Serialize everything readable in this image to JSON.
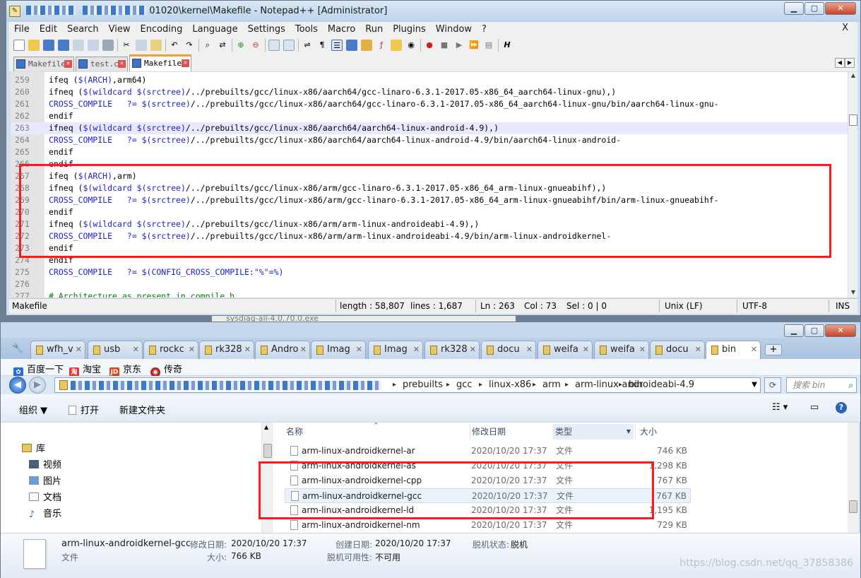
{
  "npp": {
    "title_suffix": "01020\\kernel\\Makefile - Notepad++ [Administrator]",
    "menu": [
      "File",
      "Edit",
      "Search",
      "View",
      "Encoding",
      "Language",
      "Settings",
      "Tools",
      "Macro",
      "Run",
      "Plugins",
      "Window",
      "?"
    ],
    "menu_close": "X",
    "tabs": [
      "Makefile",
      "test.c",
      "Makefile"
    ],
    "active_tab": 2,
    "lines": [
      {
        "n": "259",
        "t": "ifeq ($(ARCH),arm64)"
      },
      {
        "n": "260",
        "t": "ifneq ($(wildcard $(srctree)/../prebuilts/gcc/linux-x86/aarch64/gcc-linaro-6.3.1-2017.05-x86_64_aarch64-linux-gnu),)"
      },
      {
        "n": "261",
        "t": "CROSS_COMPILE   ?= $(srctree)/../prebuilts/gcc/linux-x86/aarch64/gcc-linaro-6.3.1-2017.05-x86_64_aarch64-linux-gnu/bin/aarch64-linux-gnu-"
      },
      {
        "n": "262",
        "t": "endif"
      },
      {
        "n": "263",
        "t": "ifneq ($(wildcard $(srctree)/../prebuilts/gcc/linux-x86/aarch64/aarch64-linux-android-4.9),)"
      },
      {
        "n": "264",
        "t": "CROSS_COMPILE   ?= $(srctree)/../prebuilts/gcc/linux-x86/aarch64/aarch64-linux-android-4.9/bin/aarch64-linux-android-"
      },
      {
        "n": "265",
        "t": "endif"
      },
      {
        "n": "266",
        "t": "endif"
      },
      {
        "n": "267",
        "t": "ifeq ($(ARCH),arm)"
      },
      {
        "n": "268",
        "t": "ifneq ($(wildcard $(srctree)/../prebuilts/gcc/linux-x86/arm/gcc-linaro-6.3.1-2017.05-x86_64_arm-linux-gnueabihf),)"
      },
      {
        "n": "269",
        "t": "CROSS_COMPILE   ?= $(srctree)/../prebuilts/gcc/linux-x86/arm/gcc-linaro-6.3.1-2017.05-x86_64_arm-linux-gnueabihf/bin/arm-linux-gnueabihf-"
      },
      {
        "n": "270",
        "t": "endif"
      },
      {
        "n": "271",
        "t": "ifneq ($(wildcard $(srctree)/../prebuilts/gcc/linux-x86/arm/arm-linux-androideabi-4.9),)"
      },
      {
        "n": "272",
        "t": "CROSS_COMPILE   ?= $(srctree)/../prebuilts/gcc/linux-x86/arm/arm-linux-androideabi-4.9/bin/arm-linux-androidkernel-"
      },
      {
        "n": "273",
        "t": "endif"
      },
      {
        "n": "274",
        "t": "endif"
      },
      {
        "n": "275",
        "t": "CROSS_COMPILE   ?= $(CONFIG_CROSS_COMPILE:\"%\"=%)"
      },
      {
        "n": "276",
        "t": ""
      },
      {
        "n": "277",
        "t": "# Architecture as present in compile.h"
      }
    ],
    "current_line_index": 4,
    "status": {
      "file": "Makefile",
      "length": "length : 58,807",
      "lines": "lines : 1,687",
      "ln": "Ln : 263",
      "col": "Col : 73",
      "sel": "Sel : 0 | 0",
      "eol": "Unix (LF)",
      "enc": "UTF-8",
      "mode": "INS"
    }
  },
  "background": {
    "filename_peek": "sysdiag-all-4.0.70.0.exe"
  },
  "explorer": {
    "tabs": [
      "wfh_v",
      "usb",
      "rockc",
      "rk328",
      "Andro",
      "Imag",
      "Imag",
      "rk328",
      "docu",
      "weifa",
      "weifa",
      "docu",
      "bin"
    ],
    "new_tab": "+",
    "favorites": [
      "百度一下",
      "淘宝",
      "京东",
      "传奇"
    ],
    "breadcrumbs": [
      "prebuilts",
      "gcc",
      "linux-x86",
      "arm",
      "arm-linux-androideabi-4.9",
      "bin"
    ],
    "search_placeholder": "搜索 bin",
    "commands": {
      "organize": "组织 ▼",
      "open": "打开",
      "new_folder": "新建文件夹"
    },
    "nav_tree": [
      {
        "label": "库",
        "level": 0
      },
      {
        "label": "视频",
        "level": 1
      },
      {
        "label": "图片",
        "level": 1
      },
      {
        "label": "文档",
        "level": 1
      },
      {
        "label": "音乐",
        "level": 1
      }
    ],
    "columns": {
      "name": "名称",
      "date": "修改日期",
      "type": "类型",
      "size": "大小"
    },
    "files": [
      {
        "name": "arm-linux-androidkernel-ar",
        "date": "2020/10/20 17:37",
        "type": "文件",
        "size": "746 KB"
      },
      {
        "name": "arm-linux-androidkernel-as",
        "date": "2020/10/20 17:37",
        "type": "文件",
        "size": "1,298 KB"
      },
      {
        "name": "arm-linux-androidkernel-cpp",
        "date": "2020/10/20 17:37",
        "type": "文件",
        "size": "767 KB"
      },
      {
        "name": "arm-linux-androidkernel-gcc",
        "date": "2020/10/20 17:37",
        "type": "文件",
        "size": "767 KB"
      },
      {
        "name": "arm-linux-androidkernel-ld",
        "date": "2020/10/20 17:37",
        "type": "文件",
        "size": "1,195 KB"
      },
      {
        "name": "arm-linux-androidkernel-nm",
        "date": "2020/10/20 17:37",
        "type": "文件",
        "size": "729 KB"
      }
    ],
    "selected_file_index": 3,
    "details": {
      "name": "arm-linux-androidkernel-gcc",
      "kind": "文件",
      "modified_label": "修改日期:",
      "modified_value": "2020/10/20 17:37",
      "size_label": "大小:",
      "size_value": "766 KB",
      "created_label": "创建日期:",
      "created_value": "2020/10/20 17:37",
      "offline_label": "脱机状态:",
      "offline_value": "脱机",
      "offline_avail_label": "脱机可用性:",
      "offline_avail_value": "不可用"
    },
    "watermark": "https://blog.csdn.net/qq_37858386"
  }
}
